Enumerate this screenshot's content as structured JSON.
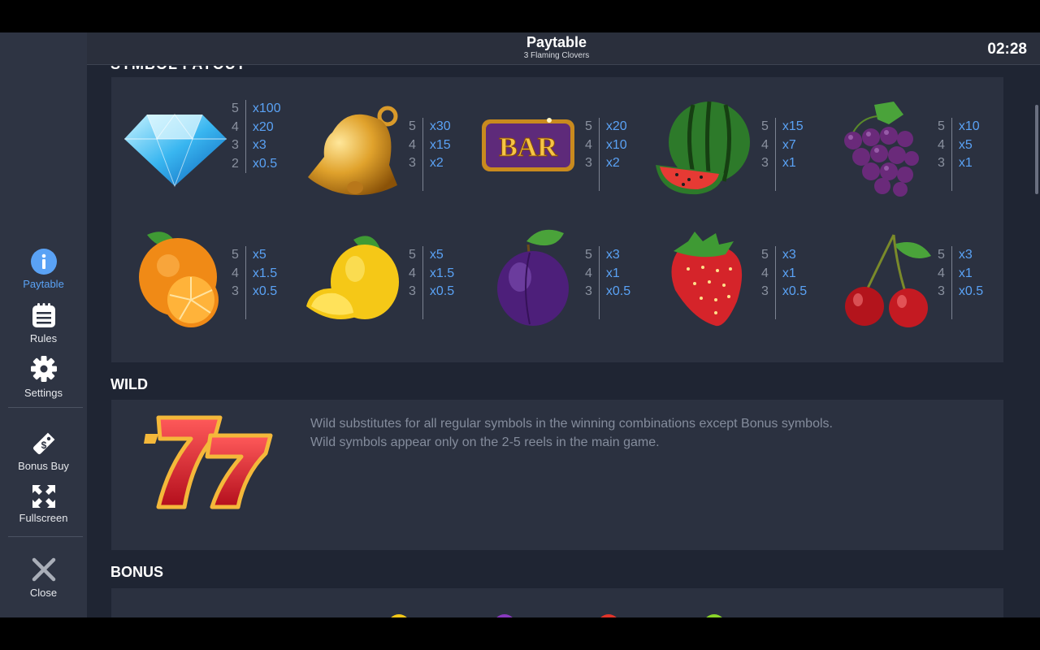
{
  "header": {
    "title": "Paytable",
    "subtitle": "3 Flaming Clovers",
    "clock": "02:28"
  },
  "sidebar": {
    "items": [
      {
        "label": "Paytable",
        "icon": "info-icon",
        "active": true
      },
      {
        "label": "Rules",
        "icon": "rules-icon"
      },
      {
        "label": "Settings",
        "icon": "gear-icon"
      },
      {
        "label": "Bonus Buy",
        "icon": "price-tag-icon"
      },
      {
        "label": "Fullscreen",
        "icon": "fullscreen-icon"
      },
      {
        "label": "Close",
        "icon": "close-icon"
      }
    ]
  },
  "symbols": [
    {
      "name": "diamond",
      "counts": [
        "5",
        "4",
        "3",
        "2"
      ],
      "values": [
        "x100",
        "x20",
        "x3",
        "x0.5"
      ]
    },
    {
      "name": "bell",
      "counts": [
        "5",
        "4",
        "3"
      ],
      "values": [
        "x30",
        "x15",
        "x2"
      ]
    },
    {
      "name": "bar",
      "text": "BAR",
      "counts": [
        "5",
        "4",
        "3"
      ],
      "values": [
        "x20",
        "x10",
        "x2"
      ]
    },
    {
      "name": "watermelon",
      "counts": [
        "5",
        "4",
        "3"
      ],
      "values": [
        "x15",
        "x7",
        "x1"
      ]
    },
    {
      "name": "grapes",
      "counts": [
        "5",
        "4",
        "3"
      ],
      "values": [
        "x10",
        "x5",
        "x1"
      ]
    },
    {
      "name": "orange",
      "counts": [
        "5",
        "4",
        "3"
      ],
      "values": [
        "x5",
        "x1.5",
        "x0.5"
      ]
    },
    {
      "name": "lemon",
      "counts": [
        "5",
        "4",
        "3"
      ],
      "values": [
        "x5",
        "x1.5",
        "x0.5"
      ]
    },
    {
      "name": "plum",
      "counts": [
        "5",
        "4",
        "3"
      ],
      "values": [
        "x3",
        "x1",
        "x0.5"
      ]
    },
    {
      "name": "strawberry",
      "counts": [
        "5",
        "4",
        "3"
      ],
      "values": [
        "x3",
        "x1",
        "x0.5"
      ]
    },
    {
      "name": "cherry",
      "counts": [
        "5",
        "4",
        "3"
      ],
      "values": [
        "x3",
        "x1",
        "x0.5"
      ]
    }
  ],
  "wild": {
    "heading": "WILD",
    "line1": "Wild substitutes for all regular symbols in the winning combinations except Bonus symbols.",
    "line2": "Wild symbols appear only on the 2-5 reels in the main game."
  },
  "bonus": {
    "heading": "BONUS"
  },
  "colors": {
    "accent": "#5aa2f5",
    "panel": "#2b3140",
    "background": "#1f2533",
    "sidebar": "#2e3443"
  }
}
